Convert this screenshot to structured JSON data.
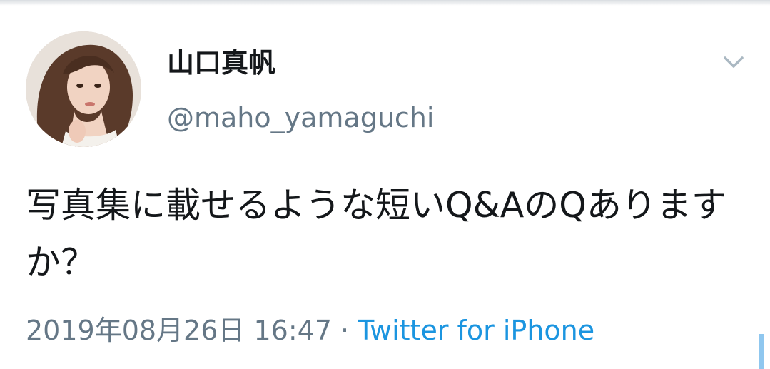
{
  "tweet": {
    "display_name": "山口真帆",
    "handle": "@maho_yamaguchi",
    "text": "写真集に載せるような短いQ&AのQありますか？",
    "timestamp": "2019年08月26日 16:47",
    "separator": "·",
    "source": "Twitter for iPhone"
  },
  "icons": {
    "caret": "chevron-down-icon",
    "avatar": "profile-photo"
  },
  "colors": {
    "text": "#14171a",
    "secondary": "#657786",
    "link": "#1b95e0"
  }
}
